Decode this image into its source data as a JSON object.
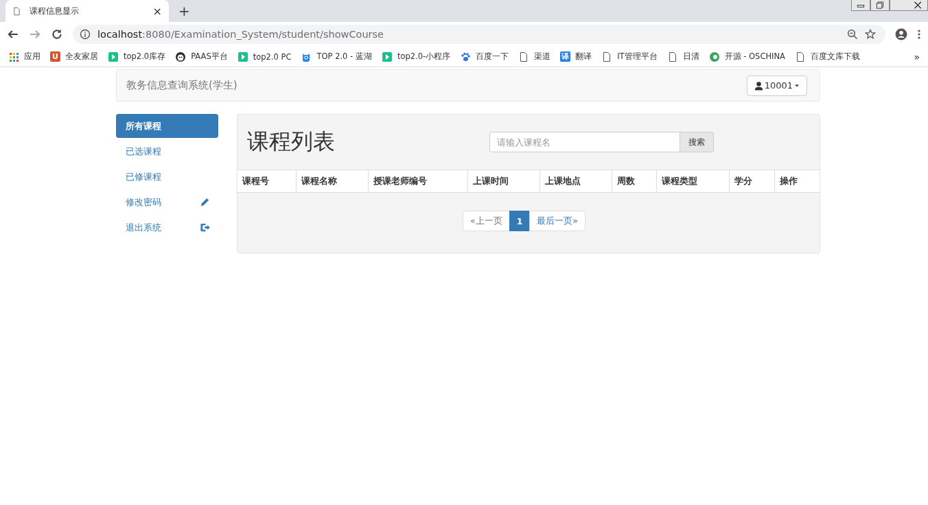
{
  "browser": {
    "tab": {
      "title": "课程信息显示",
      "close": "×"
    },
    "new_tab": "+",
    "url": {
      "host": "localhost",
      "rest": ":8080/Examination_System/student/showCourse"
    },
    "bookmarks": [
      {
        "kind": "apps",
        "label": "应用"
      },
      {
        "kind": "letter",
        "icon_text": "U",
        "color": "#d9532c",
        "label": "全友家居"
      },
      {
        "kind": "play",
        "label": "top2.0库存"
      },
      {
        "kind": "panda",
        "label": "PAAS平台"
      },
      {
        "kind": "play",
        "label": "top2.0 PC"
      },
      {
        "kind": "monster",
        "label": "TOP 2.0 - 蓝湖"
      },
      {
        "kind": "play",
        "label": "top2.0-小程序"
      },
      {
        "kind": "paw",
        "label": "百度一下"
      },
      {
        "kind": "page",
        "label": "渠道"
      },
      {
        "kind": "letter",
        "icon_text": "译",
        "color": "#2a7de1",
        "label": "翻译"
      },
      {
        "kind": "page",
        "label": "IT管理平台"
      },
      {
        "kind": "page",
        "label": "日清"
      },
      {
        "kind": "c",
        "label": "开源 - OSCHINA"
      },
      {
        "kind": "page",
        "label": "百度文库下载"
      }
    ],
    "more": "»"
  },
  "navbar": {
    "brand": "教务信息查询系统(学生)",
    "user": "10001"
  },
  "sidebar": {
    "items": [
      {
        "label": "所有课程",
        "selected": true,
        "kind": "plain"
      },
      {
        "label": "已选课程",
        "selected": false,
        "kind": "plain"
      },
      {
        "label": "已修课程",
        "selected": false,
        "kind": "plain"
      },
      {
        "label": "修改密码",
        "selected": false,
        "kind": "edit"
      },
      {
        "label": "退出系统",
        "selected": false,
        "kind": "exit"
      }
    ]
  },
  "panel": {
    "title": "课程列表",
    "search": {
      "placeholder": "请输入课程名",
      "button": "搜索"
    },
    "table": {
      "columns": [
        "课程号",
        "课程名称",
        "授课老师编号",
        "上课时间",
        "上课地点",
        "周数",
        "课程类型",
        "学分",
        "操作"
      ]
    },
    "pagination": [
      {
        "label": "«上一页",
        "selected": false
      },
      {
        "label": "1",
        "selected": true
      },
      {
        "label": "最后一页»",
        "selected": false
      }
    ]
  }
}
